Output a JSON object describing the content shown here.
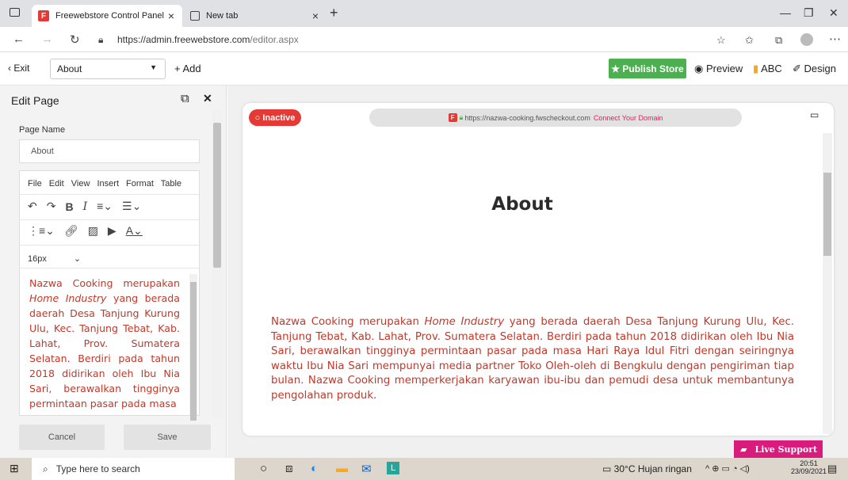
{
  "browser": {
    "tabs": [
      {
        "favicon": "F",
        "title": "Freewebstore Control Panel"
      },
      {
        "favicon": "newtab-icon",
        "title": "New tab"
      }
    ],
    "url_host": "https://admin.freewebstore.com",
    "url_path": "/editor.aspx"
  },
  "toolbar": {
    "exit": "Exit",
    "page_select": "About",
    "add": "+ Add",
    "publish": "★ Publish Store",
    "preview": "Preview",
    "abc": "ABC",
    "design": "Design"
  },
  "left_panel": {
    "title": "Edit Page",
    "page_name_label": "Page Name",
    "page_name_value": "About",
    "menu": "File Edit View Insert Format Table",
    "font_size": "16px",
    "editor_text_1": "Nazwa Cooking merupakan ",
    "editor_text_italic": "Home Industry",
    "editor_text_2": " yang berada daerah Desa Tanjung Kurung Ulu, Kec. Tanjung Tebat, Kab. Lahat, Prov. Sumatera Selatan. Berdiri pada tahun 2018 didirikan oleh Ibu Nia Sari, berawalkan tingginya permintaan pasar pada masa",
    "cancel": "Cancel",
    "save": "Save"
  },
  "preview": {
    "status": "○ Inactive",
    "url": "https://nazwa-cooking.fwscheckout.com",
    "connect": "Connect Your Domain",
    "heading": "About",
    "body_1": "Nazwa Cooking merupakan ",
    "body_italic": "Home Industry",
    "body_2": "  yang berada daerah Desa Tanjung Kurung Ulu, Kec. Tanjung Tebat, Kab. Lahat, Prov. Sumatera Selatan.  Berdiri pada tahun 2018 didirikan oleh Ibu Nia Sari, berawalkan tingginya permintaan pasar pada masa Hari Raya Idul Fitri dengan seiringnya waktu Ibu Nia Sari mempunyai media partner Toko Oleh-oleh di Bengkulu dengan pengiriman tiap bulan. Nazwa Cooking memperkerjakan karyawan ibu-ibu dan pemudi desa untuk membantunya pengolahan produk.",
    "live_support": "Live Support"
  },
  "taskbar": {
    "search_placeholder": "Type here to search",
    "weather": "30°C  Hujan ringan",
    "time": "20:51",
    "date": "23/09/2021"
  },
  "colors": {
    "accent_red": "#e53935",
    "publish_green": "#4caf50",
    "text_red": "#c0392b",
    "live_support": "#d81b7d"
  }
}
